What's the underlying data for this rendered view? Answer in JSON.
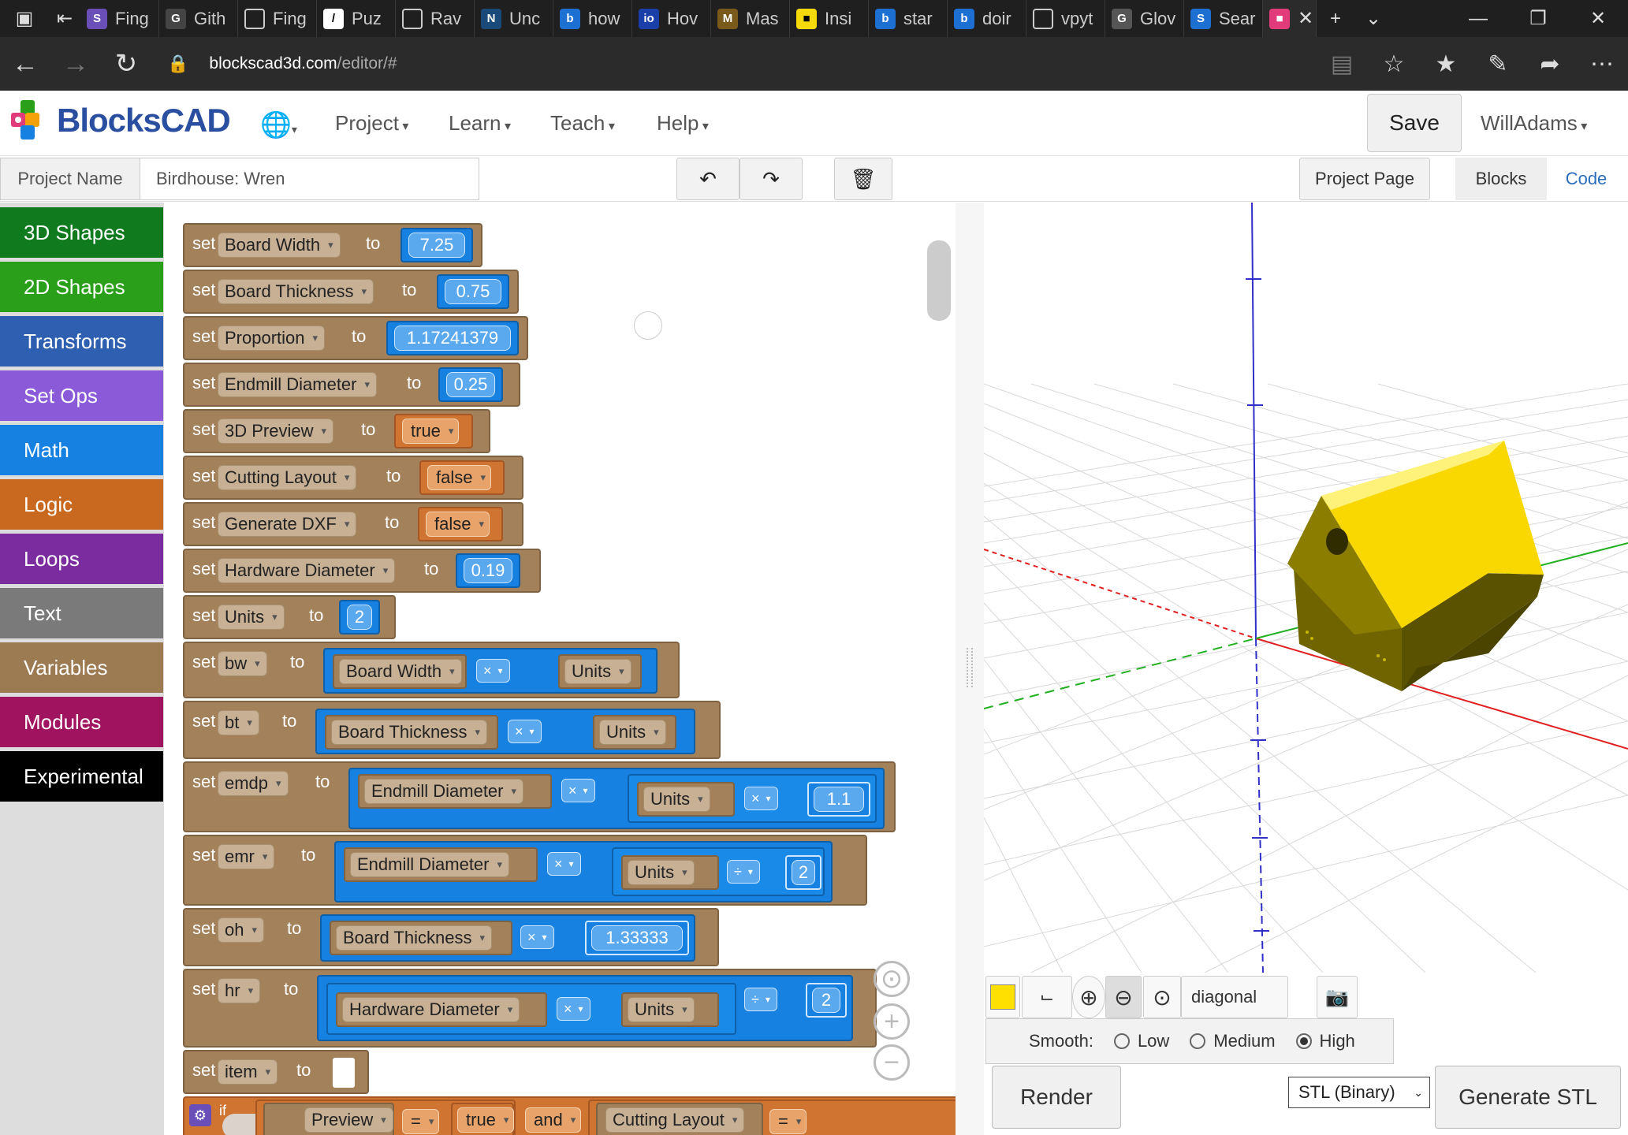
{
  "browser": {
    "tabs": [
      "Fing",
      "Gith",
      "Fing",
      "Puz",
      "Rav",
      "Unc",
      "how",
      "Hov",
      "Mas",
      "Insi",
      "star",
      "doir",
      "vpyt",
      "Glov",
      "Sear"
    ],
    "url_host": "blockscad3d.com",
    "url_path": "/editor/#"
  },
  "app": {
    "logo": "BlocksCAD",
    "menus": [
      "Project",
      "Learn",
      "Teach",
      "Help"
    ],
    "save_label": "Save",
    "user": "WillAdams"
  },
  "project": {
    "label": "Project Name",
    "name": "Birdhouse: Wren",
    "page_label": "Project Page",
    "tab_blocks": "Blocks",
    "tab_code": "Code"
  },
  "categories": [
    {
      "label": "3D Shapes",
      "color": "#0f7a1e"
    },
    {
      "label": "2D Shapes",
      "color": "#2aa01a"
    },
    {
      "label": "Transforms",
      "color": "#2e5fb0"
    },
    {
      "label": "Set Ops",
      "color": "#8a5ad8"
    },
    {
      "label": "Math",
      "color": "#1681e0"
    },
    {
      "label": "Logic",
      "color": "#c8691f"
    },
    {
      "label": "Loops",
      "color": "#7b2c9e"
    },
    {
      "label": "Text",
      "color": "#7a7a7a"
    },
    {
      "label": "Variables",
      "color": "#9c7b52"
    },
    {
      "label": "Modules",
      "color": "#a0135e"
    },
    {
      "label": "Experimental",
      "color": "#000000"
    }
  ],
  "blocks": {
    "set": "set",
    "to": "to",
    "vars": [
      "Board Width",
      "Board Thickness",
      "Proportion",
      "Endmill Diameter",
      "3D Preview",
      "Cutting Layout",
      "Generate DXF",
      "Hardware Diameter",
      "Units",
      "bw",
      "bt",
      "emdp",
      "emr",
      "oh",
      "hr",
      "item"
    ],
    "values": [
      "7.25",
      "0.75",
      "1.17241379",
      "0.25",
      "true",
      "false",
      "false",
      "0.19",
      "2"
    ],
    "ops": {
      "times": "×",
      "div": "÷",
      "eq": "=",
      "and": "and"
    },
    "numbers": [
      "1.1",
      "2",
      "1.33333",
      "2"
    ],
    "if_label": "if",
    "preview_ref": "Preview",
    "true_val": "true",
    "cutting_ref": "Cutting Layout"
  },
  "viewer": {
    "view_name": "diagonal",
    "smooth_label": "Smooth:",
    "smooth_options": [
      "Low",
      "Medium",
      "High"
    ],
    "smooth_selected": "High",
    "render_label": "Render",
    "format": "STL (Binary)",
    "generate_label": "Generate STL",
    "model_color": "#ffe000"
  }
}
